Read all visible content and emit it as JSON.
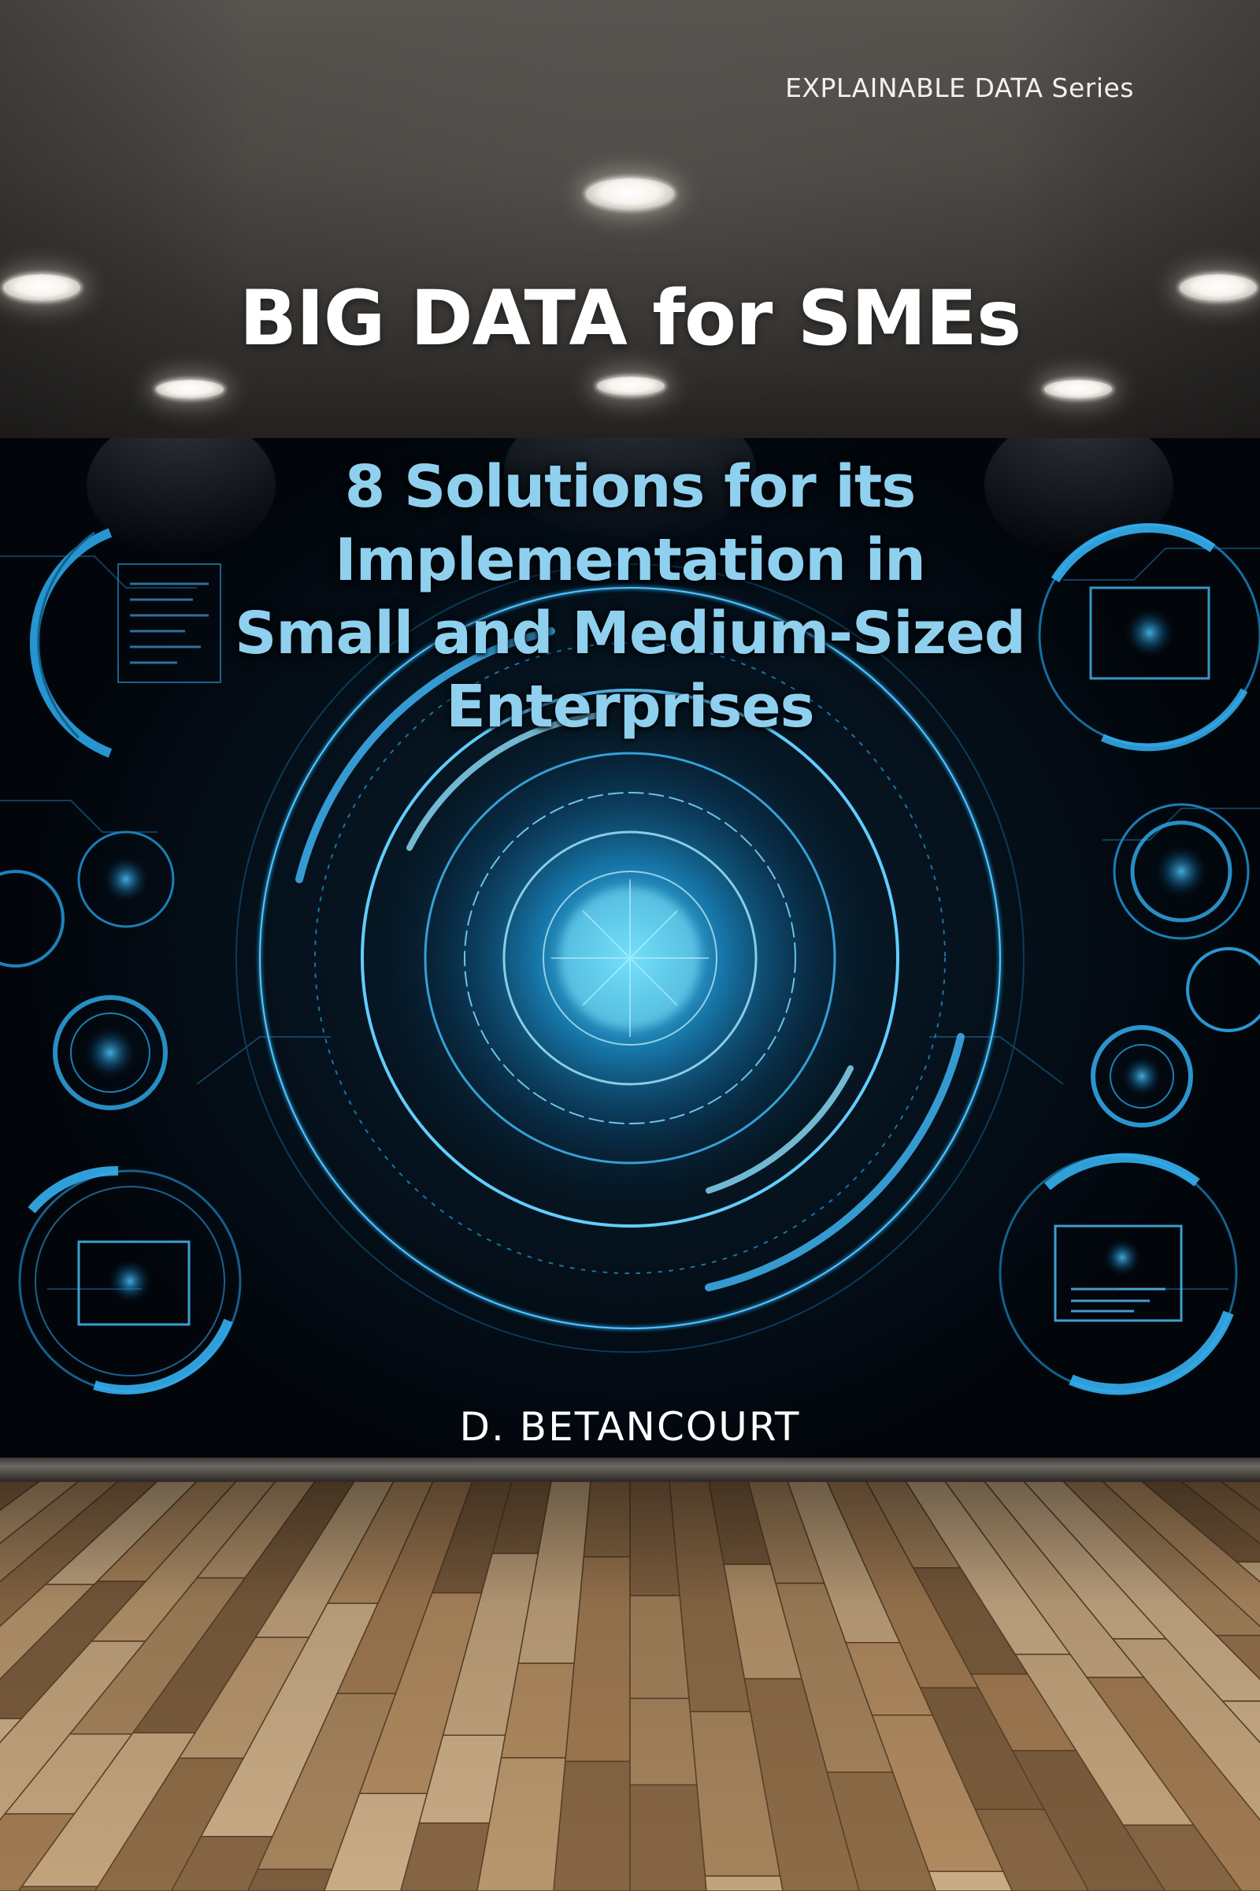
{
  "cover": {
    "series": "EXPLAINABLE DATA Series",
    "title": "BIG DATA for SMEs",
    "subtitle_lines": [
      "8 Solutions for its",
      "Implementation in",
      "Small and Medium-Sized",
      "Enterprises"
    ],
    "author": "D. BETANCOURT"
  },
  "colors": {
    "subtitle": "#8fd0ef",
    "hud_glow": "#39b6ff",
    "title": "#ffffff"
  }
}
